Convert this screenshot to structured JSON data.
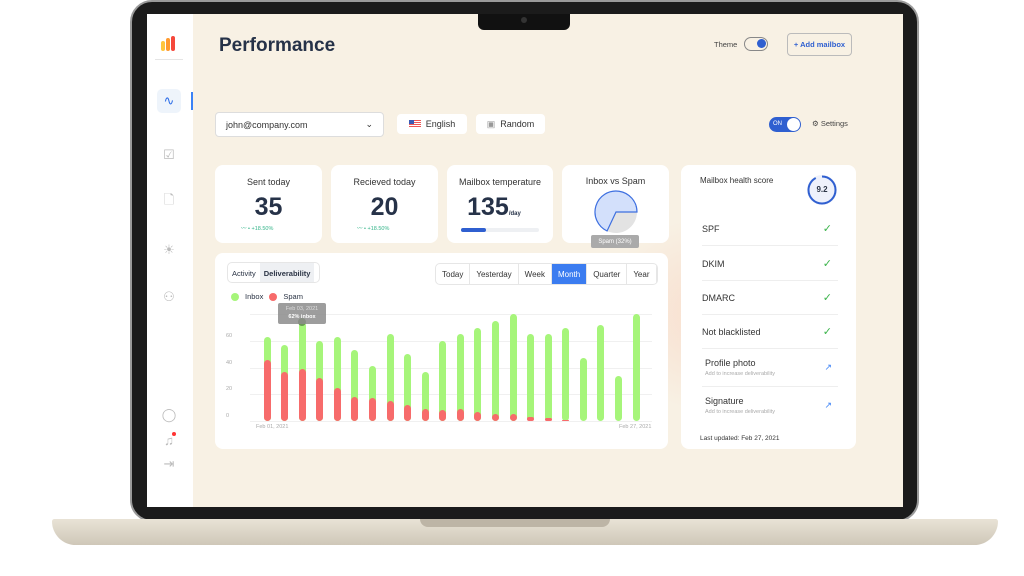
{
  "header": {
    "title": "Performance",
    "theme_label": "Theme",
    "add_mailbox": "+ Add mailbox"
  },
  "toolbar": {
    "mailbox": "john@company.com",
    "language": "English",
    "mode": "Random",
    "toggle": "ON",
    "settings": "Settings"
  },
  "sidebar": {
    "items": [
      "activity-icon",
      "tasks-icon",
      "document-icon",
      "ideas-icon",
      "user-icon"
    ],
    "bottom": [
      "chat-icon",
      "bell-icon",
      "logout-icon"
    ]
  },
  "stats": [
    {
      "title": "Sent today",
      "value": "35",
      "trend": "+18.50%"
    },
    {
      "title": "Recieved today",
      "value": "20",
      "trend": "+18.50%"
    },
    {
      "title": "Mailbox temperature",
      "value": "135",
      "unit": "/day",
      "progress": 0.32
    },
    {
      "title": "Inbox vs Spam",
      "tooltip": "Spam (32%)",
      "spam_pct": 32
    }
  ],
  "chart_tabs": {
    "activity": "Activity",
    "deliverability": "Deliverability"
  },
  "periods": [
    "Today",
    "Yesterday",
    "Week",
    "Month",
    "Quarter",
    "Year"
  ],
  "active_period": "Month",
  "tooltip": {
    "date": "Feb 03, 2021",
    "text": "62% inbox"
  },
  "chart_data": {
    "type": "bar",
    "stacked": true,
    "legend": [
      "Inbox",
      "Spam"
    ],
    "colors": {
      "Inbox": "#a6f57a",
      "Spam": "#f76b6b"
    },
    "x_start": "Feb 01, 2021",
    "x_end": "Feb 27, 2021",
    "yticks": [
      "0",
      "20",
      "40",
      "60"
    ],
    "ylim": [
      0,
      80
    ],
    "grid": true,
    "totals": [
      63,
      57,
      74,
      60,
      63,
      53,
      41,
      65,
      50,
      37,
      60,
      65,
      70,
      75,
      80,
      65,
      65,
      70,
      47,
      72,
      34,
      80
    ],
    "spam": [
      46,
      37,
      39,
      32,
      25,
      18,
      17,
      15,
      12,
      9,
      8,
      9,
      7,
      5,
      5,
      3,
      2,
      1,
      0,
      0,
      0,
      0
    ]
  },
  "health": {
    "title": "Mailbox health score",
    "score": "9.2",
    "score_fraction": 0.92,
    "checks": [
      "SPF",
      "DKIM",
      "DMARC",
      "Not blacklisted"
    ],
    "actions": [
      {
        "label": "Profile photo",
        "sub": "Add to increase deliverability"
      },
      {
        "label": "Signature",
        "sub": "Add to increase deliverability"
      }
    ],
    "updated": "Last updated: Feb 27, 2021"
  },
  "colors": {
    "accent": "#2f6fe8",
    "bg": "#f8f1e4"
  }
}
